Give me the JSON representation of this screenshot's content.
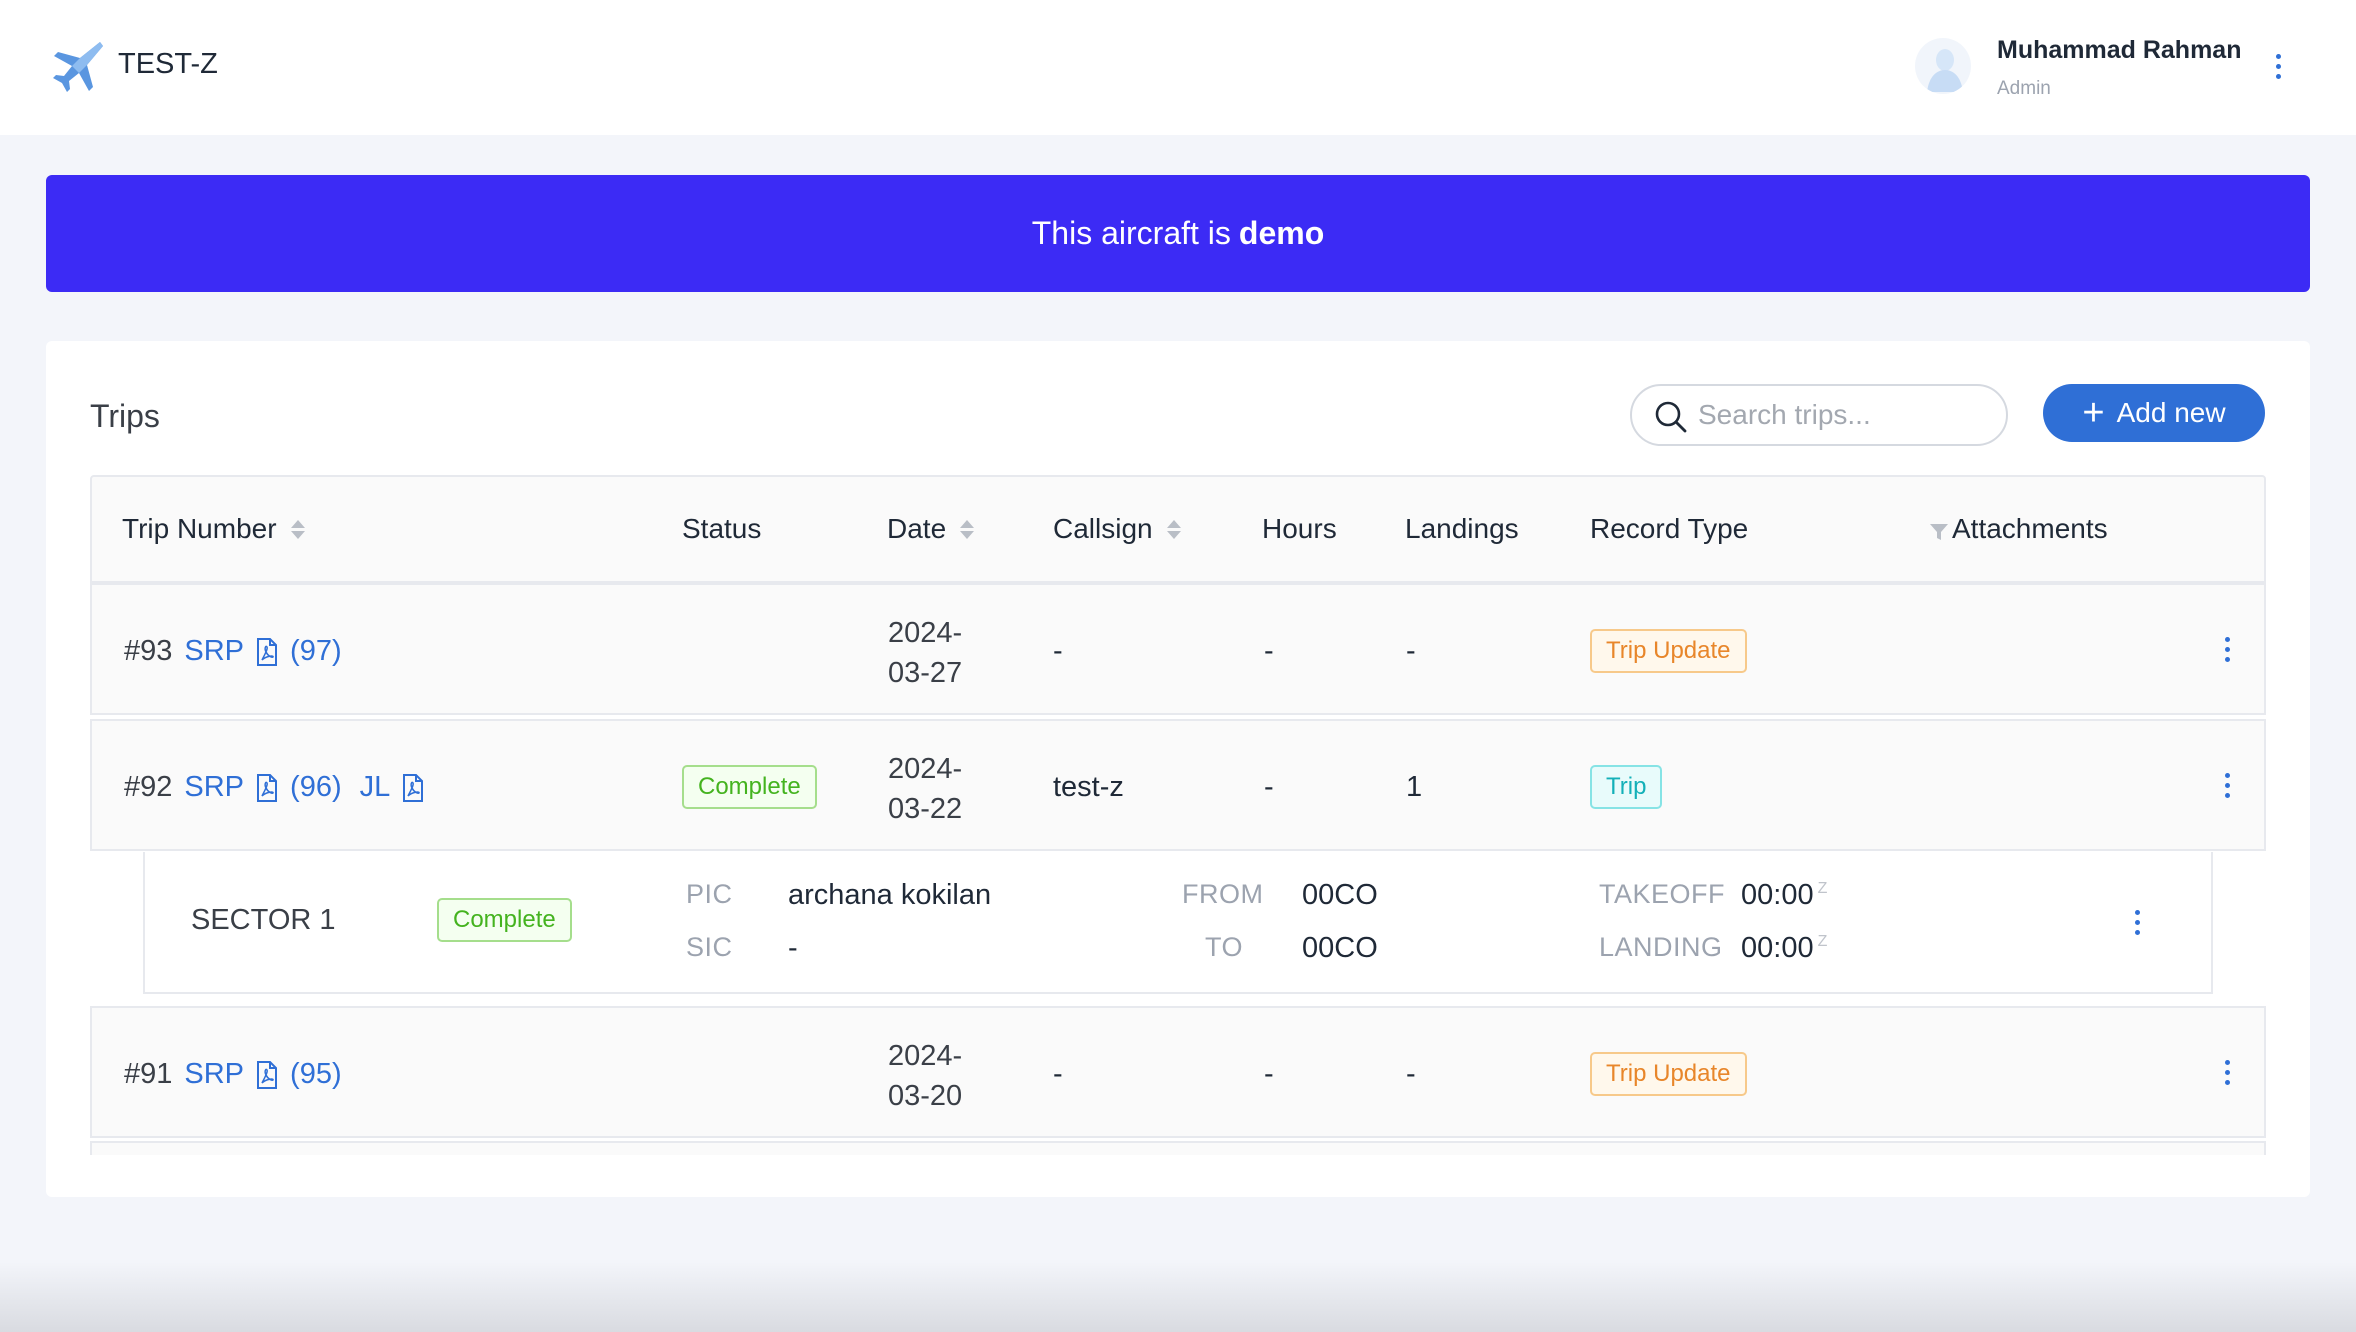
{
  "header": {
    "app_title": "TEST-Z",
    "logo_icon": "airplane-icon",
    "user": {
      "name": "Muhammad Rahman",
      "role": "Admin"
    }
  },
  "banner": {
    "text": "This aircraft is",
    "emphasis": "demo",
    "color": "#3c2bf5"
  },
  "trips": {
    "title": "Trips",
    "search_placeholder": "Search trips...",
    "add_label": "Add new",
    "columns": {
      "trip_number": "Trip Number",
      "status": "Status",
      "date": "Date",
      "callsign": "Callsign",
      "hours": "Hours",
      "landings": "Landings",
      "record_type": "Record Type",
      "attachments": "Attachments"
    },
    "rows": [
      {
        "number": "#93",
        "doc": "SRP",
        "doc_num": "(97)",
        "doc2": "",
        "status": "",
        "date": "2024-03-27",
        "callsign": "-",
        "hours": "-",
        "landings": "-",
        "record_type": "Trip Update"
      },
      {
        "number": "#92",
        "doc": "SRP",
        "doc_num": "(96)",
        "doc2": "JL",
        "status": "Complete",
        "date": "2024-03-22",
        "callsign": "test-z",
        "hours": "-",
        "landings": "1",
        "record_type": "Trip",
        "sector": {
          "name": "SECTOR 1",
          "status": "Complete",
          "pic_label": "PIC",
          "pic": "archana kokilan",
          "sic_label": "SIC",
          "sic": "-",
          "from_label": "FROM",
          "from": "00CO",
          "to_label": "TO",
          "to": "00CO",
          "takeoff_label": "TAKEOFF",
          "takeoff": "00:00",
          "landing_label": "LANDING",
          "landing": "00:00",
          "zulu": "Z"
        }
      },
      {
        "number": "#91",
        "doc": "SRP",
        "doc_num": "(95)",
        "doc2": "",
        "status": "",
        "date": "2024-03-20",
        "callsign": "-",
        "hours": "-",
        "landings": "-",
        "record_type": "Trip Update"
      }
    ]
  }
}
